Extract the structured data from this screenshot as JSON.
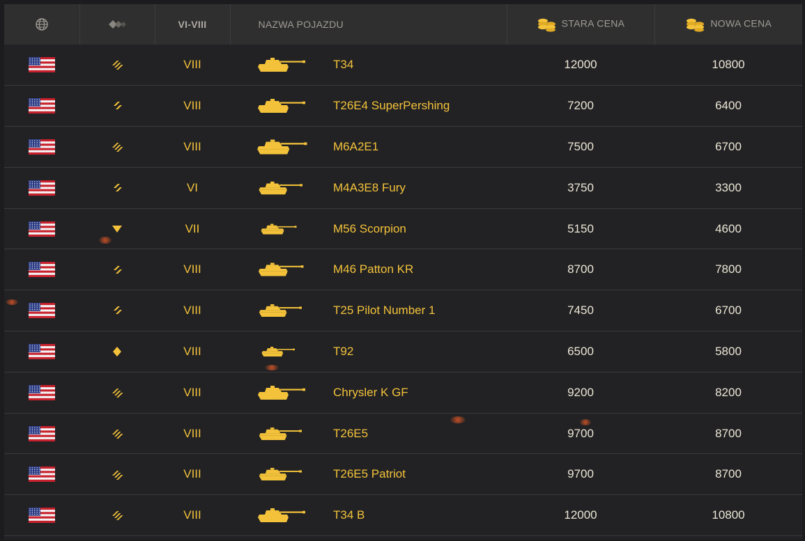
{
  "header": {
    "nation_icon": "globe-icon",
    "type_icon": "vehicle-type-icon",
    "tier": "VI-VIII",
    "name": "NAZWA POJAZDU",
    "old_price": "STARA CENA",
    "new_price": "NOWA CENA",
    "coin_icon": "gold-coins-icon"
  },
  "colors": {
    "accent": "#f3c23a",
    "background": "#222224",
    "header_bg": "#2f2f30",
    "price_text": "#ece6d6"
  },
  "vehicles": [
    {
      "nation": "usa-flag-icon",
      "type": "heavy-tank",
      "tier": "VIII",
      "name": "T34",
      "old_price": "12000",
      "new_price": "10800"
    },
    {
      "nation": "usa-flag-icon",
      "type": "medium-tank",
      "tier": "VIII",
      "name": "T26E4 SuperPershing",
      "old_price": "7200",
      "new_price": "6400"
    },
    {
      "nation": "usa-flag-icon",
      "type": "heavy-tank",
      "tier": "VIII",
      "name": "M6A2E1",
      "old_price": "7500",
      "new_price": "6700"
    },
    {
      "nation": "usa-flag-icon",
      "type": "medium-tank",
      "tier": "VI",
      "name": "M4A3E8 Fury",
      "old_price": "3750",
      "new_price": "3300"
    },
    {
      "nation": "usa-flag-icon",
      "type": "tank-destroyer",
      "tier": "VII",
      "name": "M56 Scorpion",
      "old_price": "5150",
      "new_price": "4600"
    },
    {
      "nation": "usa-flag-icon",
      "type": "medium-tank",
      "tier": "VIII",
      "name": "M46 Patton KR",
      "old_price": "8700",
      "new_price": "7800"
    },
    {
      "nation": "usa-flag-icon",
      "type": "medium-tank",
      "tier": "VIII",
      "name": "T25 Pilot Number 1",
      "old_price": "7450",
      "new_price": "6700"
    },
    {
      "nation": "usa-flag-icon",
      "type": "light-tank",
      "tier": "VIII",
      "name": "T92",
      "old_price": "6500",
      "new_price": "5800"
    },
    {
      "nation": "usa-flag-icon",
      "type": "heavy-tank",
      "tier": "VIII",
      "name": "Chrysler K GF",
      "old_price": "9200",
      "new_price": "8200"
    },
    {
      "nation": "usa-flag-icon",
      "type": "heavy-tank",
      "tier": "VIII",
      "name": "T26E5",
      "old_price": "9700",
      "new_price": "8700"
    },
    {
      "nation": "usa-flag-icon",
      "type": "heavy-tank",
      "tier": "VIII",
      "name": "T26E5 Patriot",
      "old_price": "9700",
      "new_price": "8700"
    },
    {
      "nation": "usa-flag-icon",
      "type": "heavy-tank",
      "tier": "VIII",
      "name": "T34 B",
      "old_price": "12000",
      "new_price": "10800"
    }
  ]
}
